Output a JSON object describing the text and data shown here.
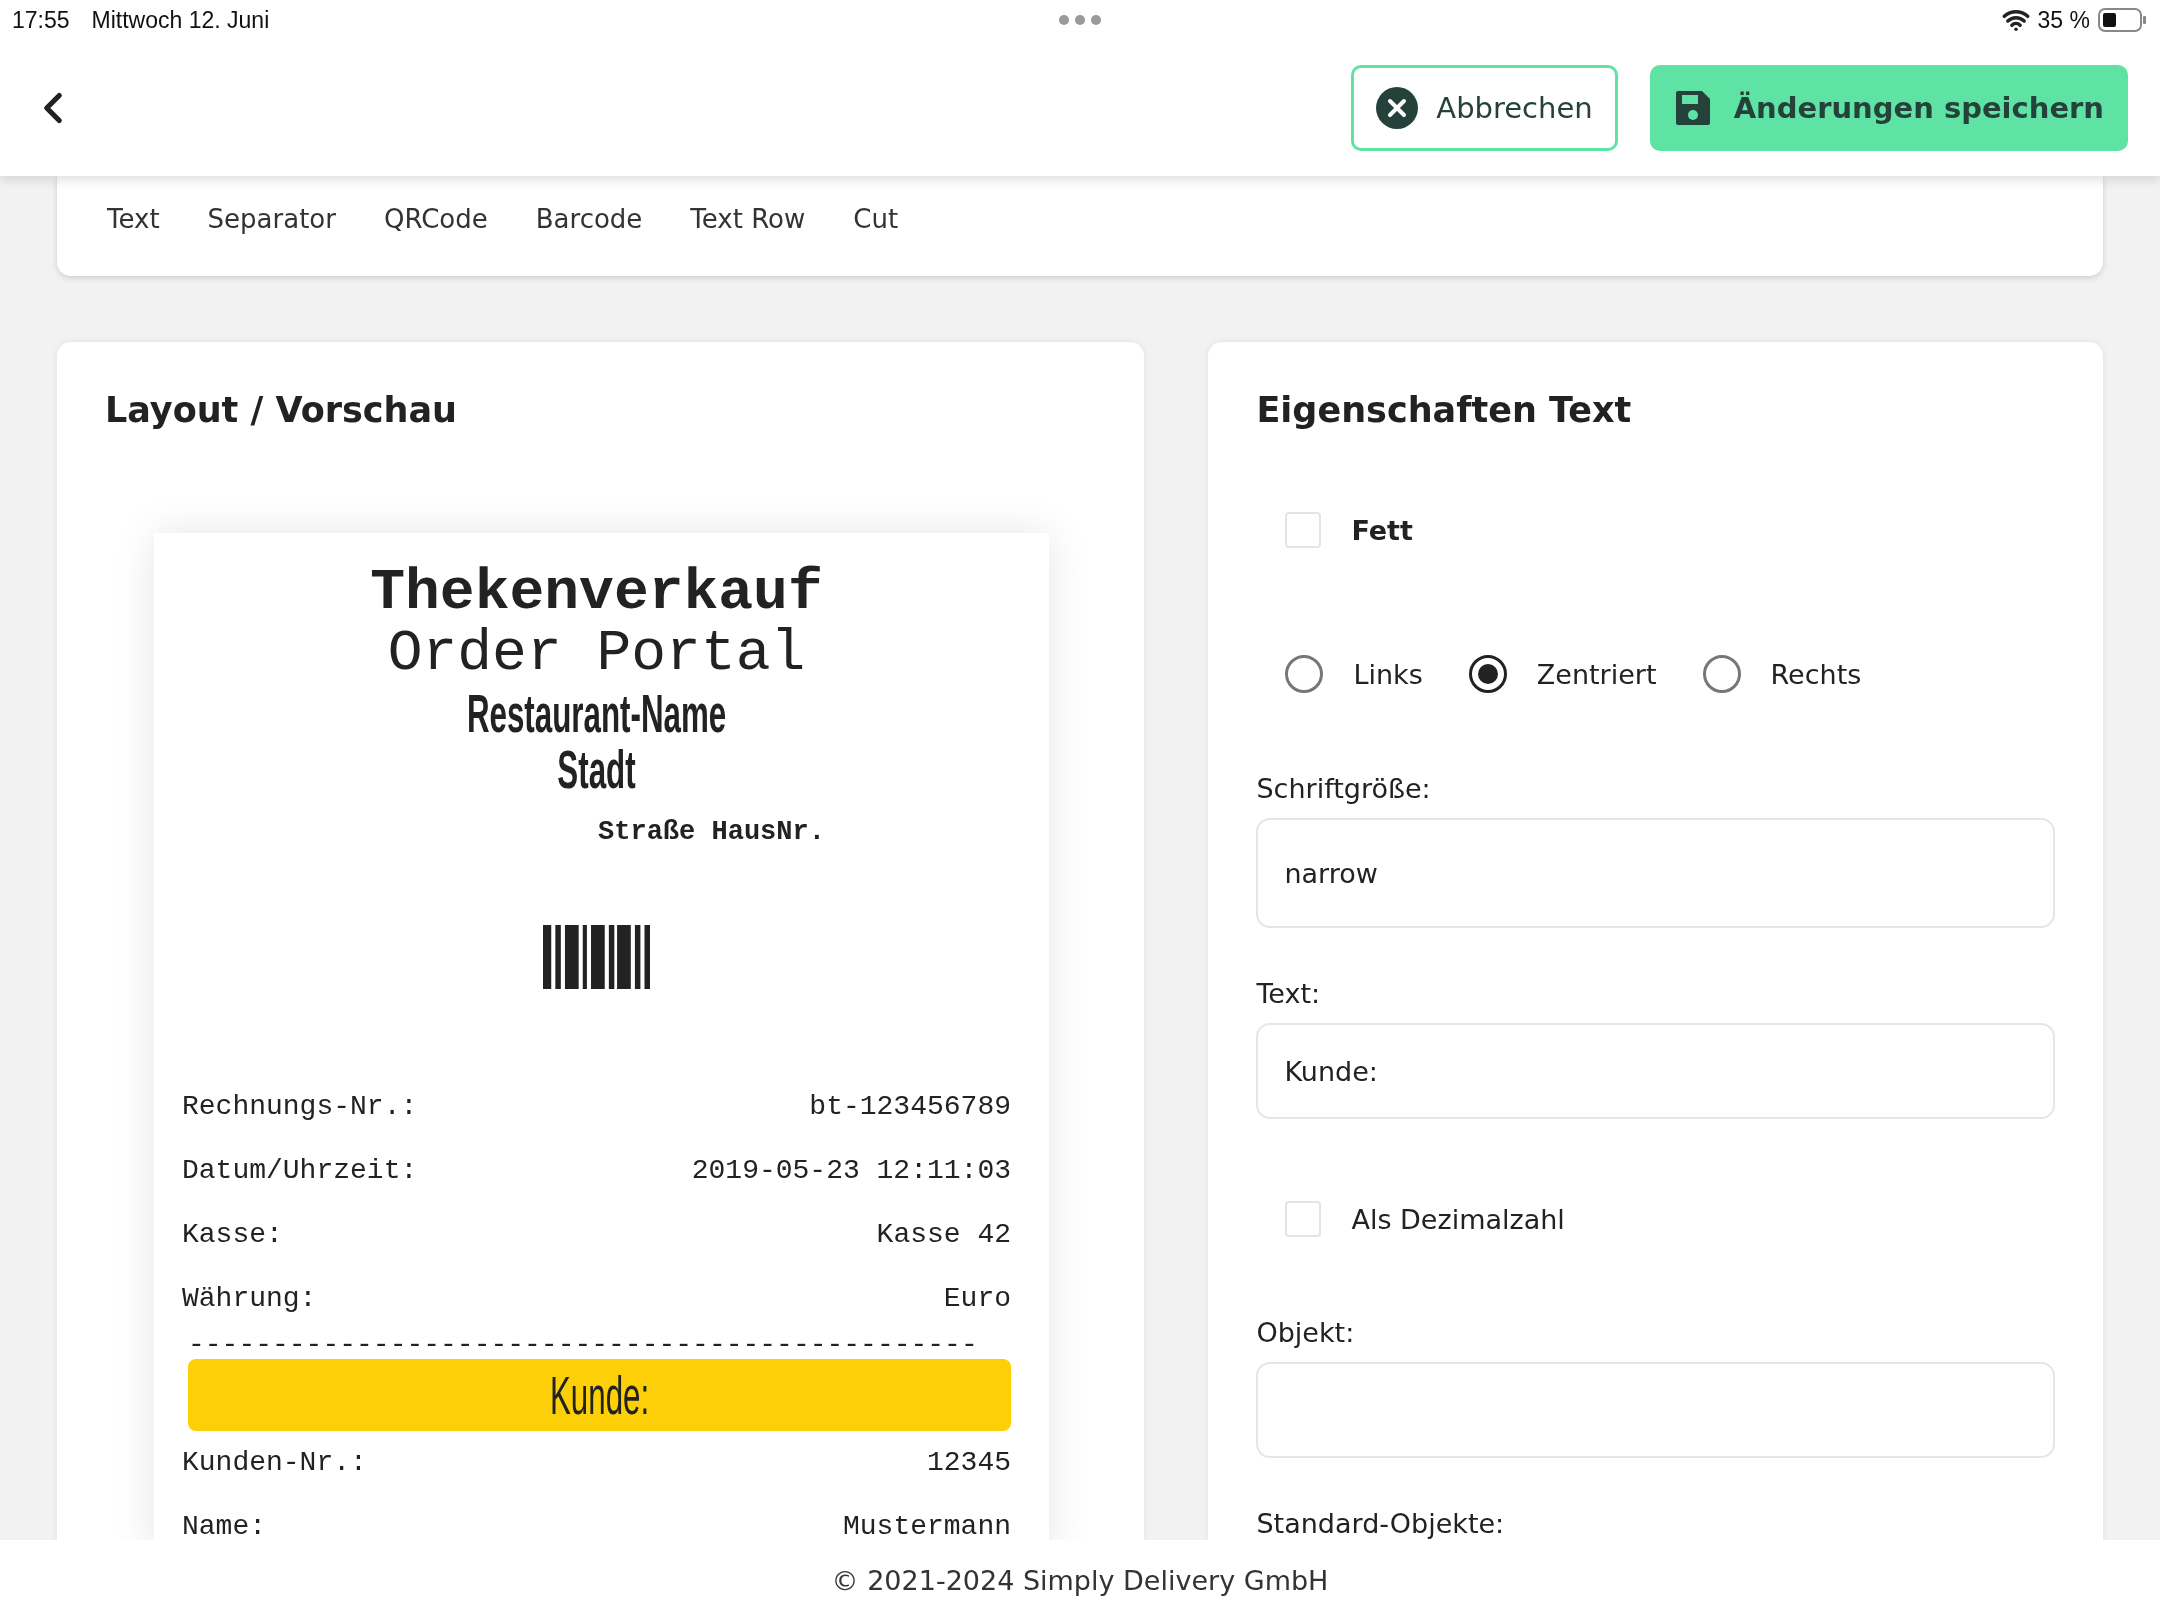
{
  "status_bar": {
    "time": "17:55",
    "date": "Mittwoch 12. Juni",
    "battery": "35 %"
  },
  "header": {
    "cancel_button": "Abbrechen",
    "save_button": "Änderungen speichern"
  },
  "toolbox": {
    "items": [
      "Text",
      "Separator",
      "QRCode",
      "Barcode",
      "Text Row",
      "Cut"
    ]
  },
  "preview": {
    "title": "Layout / Vorschau",
    "receipt": [
      {
        "kind": "title",
        "text": "Thekenverkauf"
      },
      {
        "kind": "subtitle",
        "text": "Order Portal"
      },
      {
        "kind": "heading",
        "text": "Restaurant-Name"
      },
      {
        "kind": "heading",
        "text": "Stadt"
      },
      {
        "kind": "address",
        "text": "Straße HausNr."
      },
      {
        "kind": "barcode"
      },
      {
        "kind": "row",
        "label": "Rechnungs-Nr.:",
        "value": "bt-123456789"
      },
      {
        "kind": "row",
        "label": "Datum/Uhrzeit:",
        "value": "2019-05-23 12:11:03"
      },
      {
        "kind": "row",
        "label": "Kasse:",
        "value": "Kasse 42"
      },
      {
        "kind": "row",
        "label": "Währung:",
        "value": "Euro"
      },
      {
        "kind": "separator",
        "text": "-----------------------------------------------"
      },
      {
        "kind": "highlight",
        "text": "Kunde:"
      },
      {
        "kind": "row",
        "label": "Kunden-Nr.:",
        "value": "12345"
      },
      {
        "kind": "row",
        "label": "Name:",
        "value": "Mustermann"
      }
    ]
  },
  "properties": {
    "title": "Eigenschaften Text",
    "bold": {
      "label": "Fett",
      "checked": false
    },
    "alignment": [
      {
        "label": "Links",
        "selected": false
      },
      {
        "label": "Zentriert",
        "selected": true
      },
      {
        "label": "Rechts",
        "selected": false
      }
    ],
    "font_size": {
      "label": "Schriftgröße:",
      "value": "narrow"
    },
    "text": {
      "label": "Text:",
      "value": "Kunde:"
    },
    "decimal": {
      "label": "Als Dezimalzahl",
      "checked": false
    },
    "object": {
      "label": "Objekt:"
    },
    "standard_objects": {
      "label": "Standard-Objekte:"
    }
  },
  "footer": "© 2021-2024 Simply Delivery GmbH"
}
